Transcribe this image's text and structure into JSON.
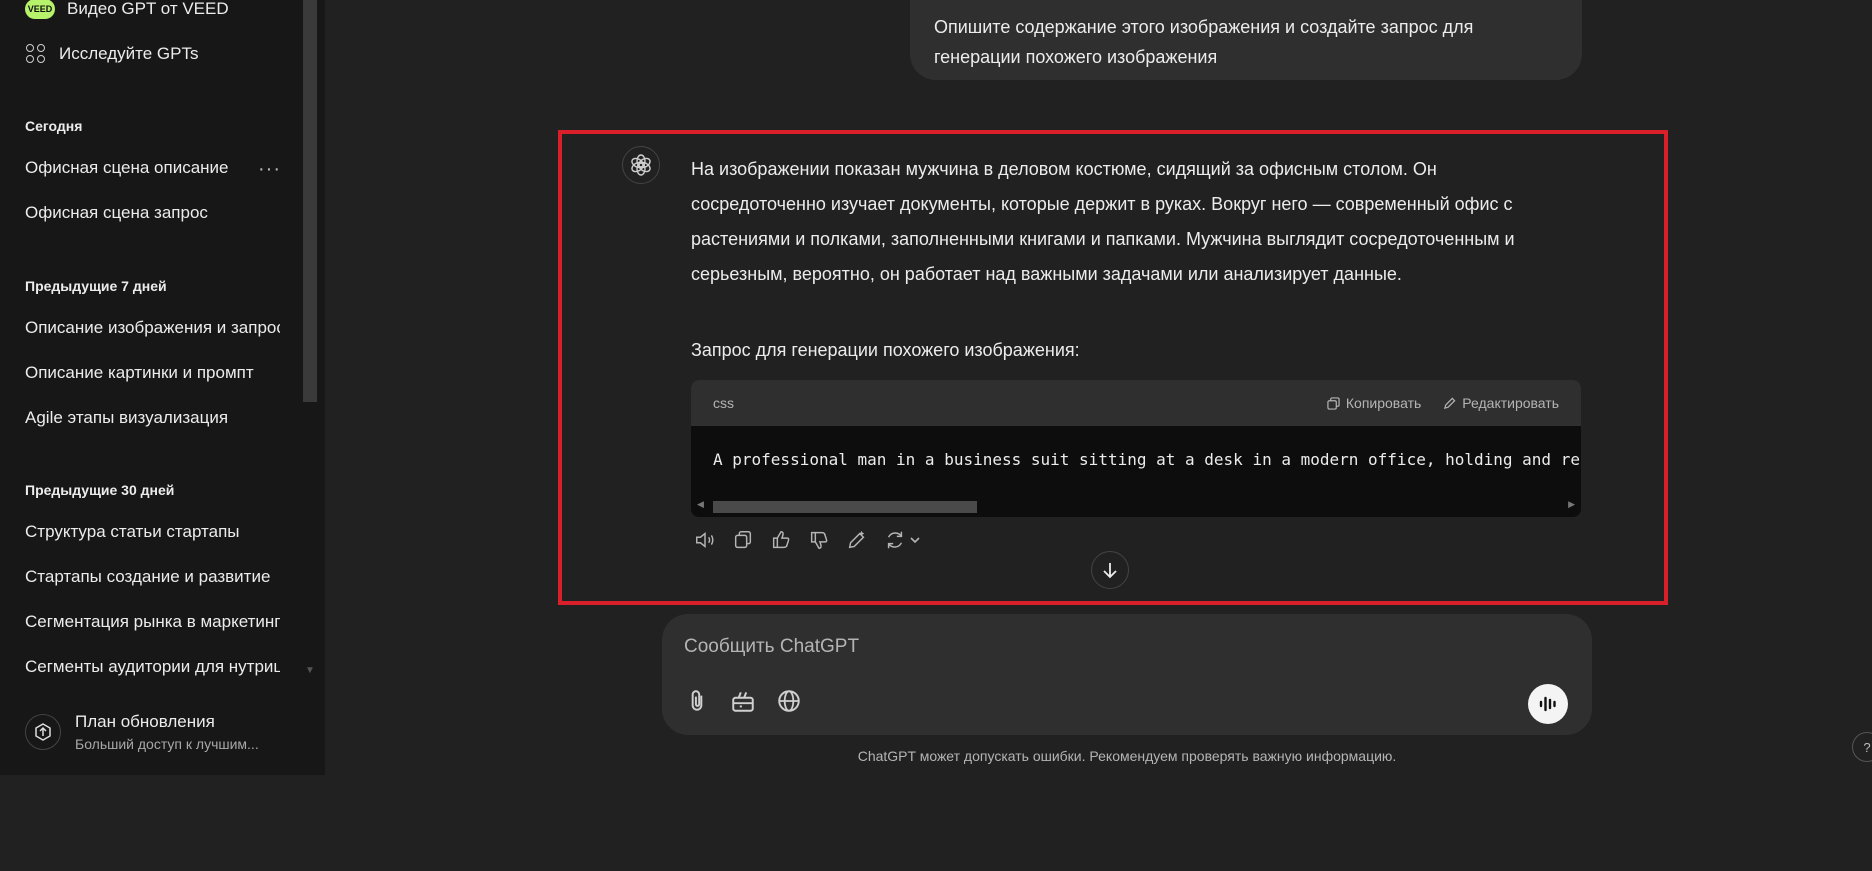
{
  "sidebar": {
    "gpt_item": {
      "badge": "VEED",
      "label": "Видео GPT от VEED"
    },
    "explore_label": "Исследуйте GPTs",
    "sections": [
      {
        "title": "Сегодня",
        "items": [
          "Офисная сцена описание",
          "Офисная сцена запрос"
        ]
      },
      {
        "title": "Предыдущие 7 дней",
        "items": [
          "Описание изображения и запрос",
          "Описание картинки и промпт",
          "Agile этапы визуализация"
        ]
      },
      {
        "title": "Предыдущие 30 дней",
        "items": [
          "Структура статьи стартапы",
          "Стартапы создание и развитие",
          "Сегментация рынка в маркетинге",
          "Сегменты аудитории для нутрициологов"
        ]
      }
    ],
    "more_dots": "···",
    "upgrade": {
      "title": "План обновления",
      "subtitle": "Больший доступ к лучшим..."
    }
  },
  "conversation": {
    "user_message": "Опишите содержание этого изображения и создайте запрос для генерации похожего изображения",
    "assistant_text": "На изображении показан мужчина в деловом костюме, сидящий за офисным столом. Он сосредоточенно изучает документы, которые держит в руках. Вокруг него — современный офис с растениями и полками, заполненными книгами и папками. Мужчина выглядит сосредоточенным и серьезным, вероятно, он работает над важными задачами или анализирует данные.",
    "prompt_label": "Запрос для генерации похожего изображения:",
    "code": {
      "language": "css",
      "copy_label": "Копировать",
      "edit_label": "Редактировать",
      "content": "A professional man in a business suit sitting at a desk in a modern office, holding and re"
    }
  },
  "composer": {
    "placeholder": "Сообщить ChatGPT"
  },
  "disclaimer": "ChatGPT может допускать ошибки. Рекомендуем проверять важную информацию.",
  "help_label": "?",
  "colors": {
    "highlight": "#d9202a",
    "veed": "#b6f36a",
    "background": "#212121",
    "sidebar": "#171717"
  }
}
